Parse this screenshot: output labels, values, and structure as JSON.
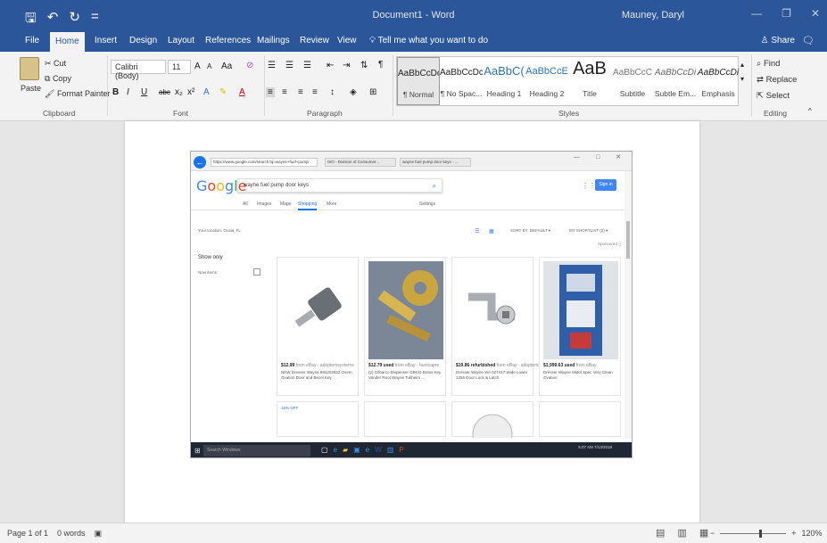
{
  "titlebar": {
    "qat_save": "🖫",
    "qat_undo": "↶",
    "qat_redo": "↻",
    "qat_more": "=",
    "title": "Document1 - Word",
    "user": "Mauney, Daryl",
    "min": "—",
    "restore": "❐",
    "close": "✕"
  },
  "tabs": [
    "File",
    "Home",
    "Insert",
    "Design",
    "Layout",
    "References",
    "Mailings",
    "Review",
    "View"
  ],
  "tell_me": "Tell me what you want to do",
  "share": "Share",
  "clipboard": {
    "paste": "Paste",
    "cut": "Cut",
    "copy": "Copy",
    "format_painter": "Format Painter",
    "label": "Clipboard"
  },
  "font": {
    "name": "Calibri (Body)",
    "size": "11",
    "grow": "A",
    "shrink": "A",
    "case": "Aa",
    "bold": "B",
    "italic": "I",
    "underline": "U",
    "strike": "abc",
    "sub": "x₂",
    "sup": "x²",
    "label": "Font"
  },
  "paragraph": {
    "label": "Paragraph",
    "pilcrow": "¶"
  },
  "styles": {
    "label": "Styles",
    "items": [
      {
        "preview": "AaBbCcDc",
        "label": "¶ Normal"
      },
      {
        "preview": "AaBbCcDc",
        "label": "¶ No Spac..."
      },
      {
        "preview": "AaBbC(",
        "label": "Heading 1"
      },
      {
        "preview": "AaBbCcE",
        "label": "Heading 2"
      },
      {
        "preview": "AaB",
        "label": "Title"
      },
      {
        "preview": "AaBbCcC",
        "label": "Subtitle"
      },
      {
        "preview": "AaBbCcDi",
        "label": "Subtle Em..."
      },
      {
        "preview": "AaBbCcDi",
        "label": "Emphasis"
      }
    ]
  },
  "editing": {
    "find": "Find",
    "replace": "Replace",
    "select": "Select",
    "label": "Editing"
  },
  "screenshot": {
    "address": "https://www.google.com/search?q=wayne+fuel+pump",
    "tab1": "ISO - Division of Consumer...",
    "tab2": "wayne fuel pump door keys - ...",
    "window_controls": "— □ ✕",
    "logo": "Google",
    "query": "wayne fuel pump door keys",
    "signin": "Sign in",
    "nav": [
      "All",
      "Images",
      "Maps",
      "Shopping",
      "More",
      "Settings"
    ],
    "location": "Your location: Ocala, FL",
    "show_only": "Show only",
    "new_items": "New items",
    "sort": "SORT BY: DEFAULT ▾",
    "shortlist": "MY SHORTLIST (0) ▾",
    "sponsored": "Sponsored ⓘ",
    "cards": [
      {
        "price": "$12.99",
        "seller": " from eBay · adoptemsystems",
        "desc": "NEW Dresser Wayne 891202822 Ovem Ovation Door and Bezel Key ..."
      },
      {
        "price": "$12.79 used",
        "seller": " from eBay · huntcapre",
        "desc": "(2) Gilbarco Dispenser GBCO Brass Key Vander Root Wayne Tokheim ..."
      },
      {
        "price": "$19.86 refurbished",
        "seller": " from eBay · adoptemsystems",
        "desc": "Dresser Wayne WA 027417 Wide Lower 1256 Door Lock & Latch"
      },
      {
        "price": "$1,999.63 used",
        "seller": " from eBay",
        "desc": "Dresser Wayne Midel Spec Very Clean Ovation"
      }
    ],
    "off_badge": "15% OFF",
    "taskbar_search": "Search Windows",
    "tray": "5:07 AM\n7/13/2018"
  },
  "status": {
    "page": "Page 1 of 1",
    "words": "0 words",
    "zoom": "120%"
  }
}
